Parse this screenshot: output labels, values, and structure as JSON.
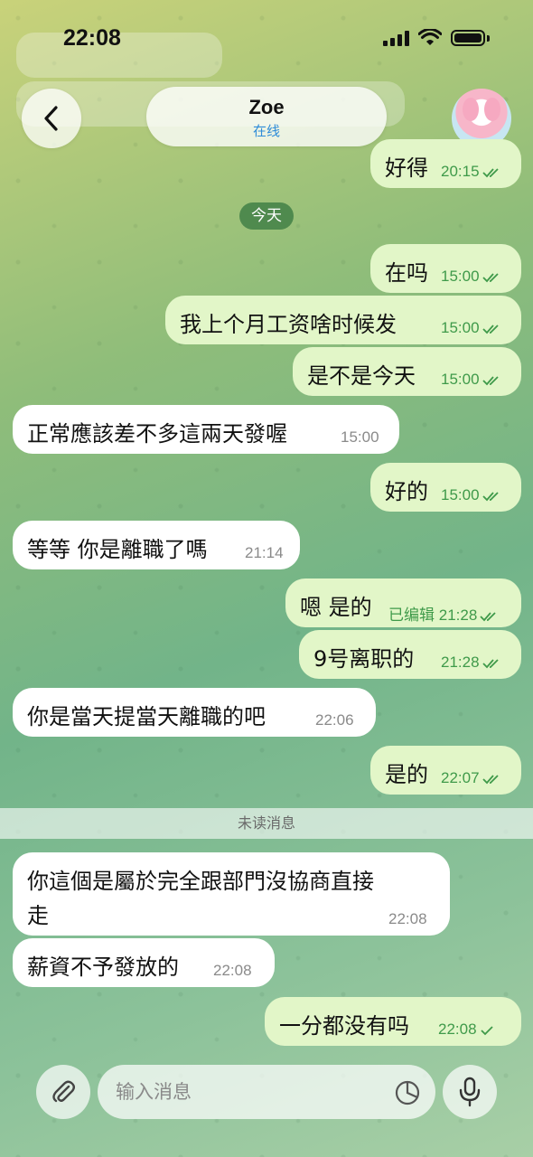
{
  "status_bar": {
    "time": "22:08"
  },
  "header": {
    "contact_name": "Zoe",
    "contact_status": "在线"
  },
  "date_divider": "今天",
  "unread_divider": "未读消息",
  "top_partial_message": {
    "text": "好得",
    "time": "20:15"
  },
  "messages": [
    {
      "text": "在吗",
      "time": "15:00",
      "direction": "out",
      "read": true
    },
    {
      "text": "我上个月工资啥时候发",
      "time": "15:00",
      "direction": "out",
      "read": true
    },
    {
      "text": "是不是今天",
      "time": "15:00",
      "direction": "out",
      "read": true
    },
    {
      "text": "正常應該差不多這兩天發喔",
      "time": "15:00",
      "direction": "in"
    },
    {
      "text": "好的",
      "time": "15:00",
      "direction": "out",
      "read": true
    },
    {
      "text": "等等 你是離職了嗎",
      "time": "21:14",
      "direction": "in"
    },
    {
      "text": "嗯 是的",
      "edited": "已编辑",
      "time": "21:28",
      "direction": "out",
      "read": true
    },
    {
      "text": "9号离职的",
      "time": "21:28",
      "direction": "out",
      "read": true
    },
    {
      "text": "你是當天提當天離職的吧",
      "time": "22:06",
      "direction": "in"
    },
    {
      "text": "是的",
      "time": "22:07",
      "direction": "out",
      "read": true
    },
    {
      "text": "你這個是屬於完全跟部門沒協商直接",
      "text_line2": "走",
      "time": "22:08",
      "direction": "in"
    },
    {
      "text": "薪資不予發放的",
      "time": "22:08",
      "direction": "in"
    },
    {
      "text": "一分都没有吗",
      "time": "22:08",
      "direction": "out",
      "read": false
    }
  ],
  "input": {
    "placeholder": "输入消息"
  },
  "colors": {
    "outgoing_bubble": "#e2f6c8",
    "incoming_bubble": "#ffffff",
    "meta_green": "#3f9a4a",
    "online_blue": "#2f8cd8"
  }
}
